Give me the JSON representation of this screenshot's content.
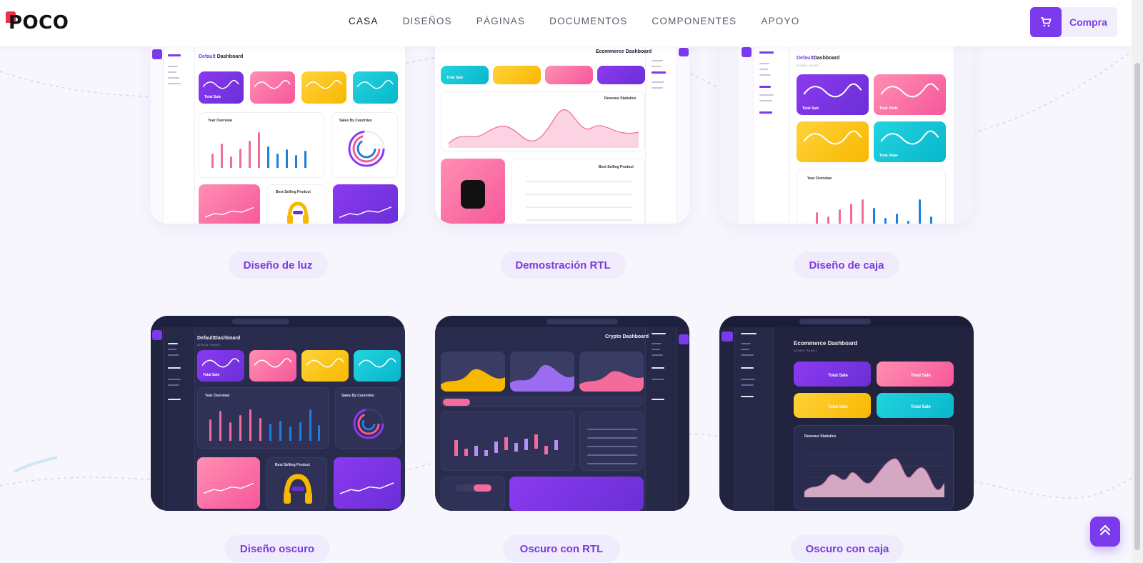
{
  "header": {
    "logo": "POCO",
    "nav": [
      {
        "label": "CASA",
        "active": true
      },
      {
        "label": "DISEÑOS",
        "active": false
      },
      {
        "label": "PÁGINAS",
        "active": false
      },
      {
        "label": "DOCUMENTOS",
        "active": false
      },
      {
        "label": "COMPONENTES",
        "active": false
      },
      {
        "label": "APOYO",
        "active": false
      }
    ],
    "buy_label": "Compra",
    "buy_icon": "cart-icon"
  },
  "demos": [
    {
      "label": "Diseño de luz",
      "theme": "light",
      "layout": "default"
    },
    {
      "label": "Demostración RTL",
      "theme": "light",
      "layout": "rtl"
    },
    {
      "label": "Diseño de caja",
      "theme": "light",
      "layout": "box"
    },
    {
      "label": "Diseño oscuro",
      "theme": "dark",
      "layout": "default"
    },
    {
      "label": "Oscuro con RTL",
      "theme": "dark",
      "layout": "rtl"
    },
    {
      "label": "Oscuro con caja",
      "theme": "dark",
      "layout": "box"
    }
  ],
  "previews": {
    "default_title": "Default",
    "default_title_2": "Dashboard",
    "ecommerce_title": "Ecommerce Dashboard",
    "crypto_title": "Crypto Dashboard",
    "admin_panel": "ADMIN PANEL",
    "year_overview": "Year Overview",
    "sales_by_countries": "Sales By Countries",
    "revenue_statistics": "Revenue Statistics",
    "best_selling_product": "Best Selling Product",
    "total_sale": "Total Sale",
    "total_visits": "Total Visits",
    "total_value": "Total Value"
  },
  "colors": {
    "accent": "#7c3aed",
    "pink": "#f6579a",
    "yellow": "#f8b800",
    "cyan": "#08b7cb",
    "dark_card": "#2a2c4e"
  },
  "scroll_top_icon": "double-chevron-up-icon"
}
